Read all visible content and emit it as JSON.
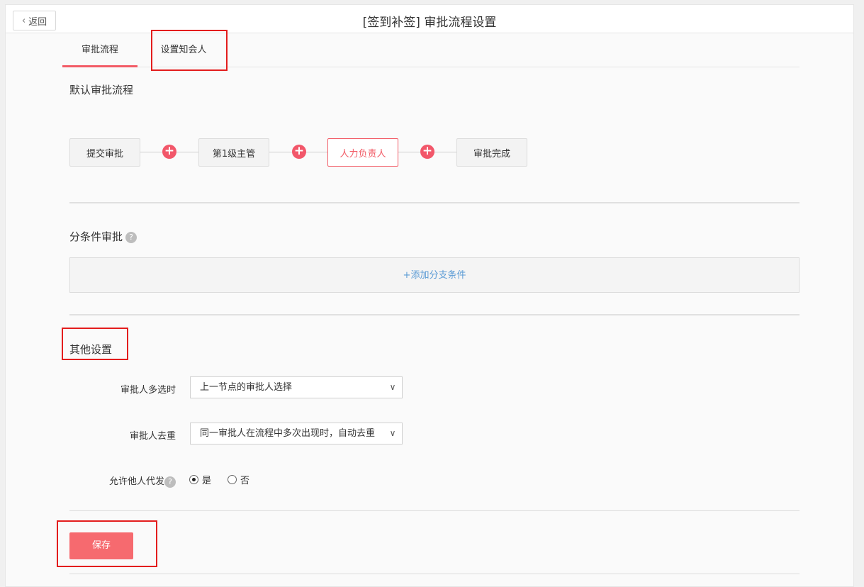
{
  "header": {
    "back_label": "返回",
    "title": "[签到补签] 审批流程设置"
  },
  "tabs": [
    {
      "label": "审批流程",
      "active": true
    },
    {
      "label": "设置知会人",
      "active": false
    }
  ],
  "default_flow": {
    "title": "默认审批流程",
    "nodes": [
      "提交审批",
      "第1级主管",
      "人力负责人",
      "审批完成"
    ],
    "add_symbol": "+"
  },
  "conditional": {
    "title": "分条件审批",
    "help": "?",
    "add_branch_label": "+添加分支条件"
  },
  "other_settings": {
    "title": "其他设置",
    "multi_select_label": "审批人多选时",
    "multi_select_value": "上一节点的审批人选择",
    "dedup_label": "审批人去重",
    "dedup_value": "同一审批人在流程中多次出现时，自动去重",
    "delegate_label": "允许他人代发",
    "delegate_help": "?",
    "options": [
      {
        "label": "是",
        "checked": true
      },
      {
        "label": "否",
        "checked": false
      }
    ]
  },
  "save_label": "保存",
  "icons": {
    "back": "chevron-left-icon",
    "dropdown": "chevron-down-icon",
    "help": "question-icon",
    "add": "plus-circle-icon"
  },
  "colors": {
    "accent": "#f25b66",
    "save": "#f66a6f",
    "link": "#5b9bd5",
    "highlight_box": "#e31d1d"
  }
}
